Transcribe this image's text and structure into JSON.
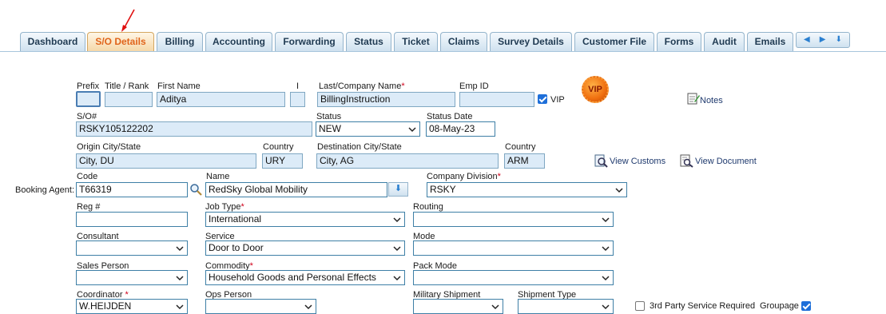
{
  "tabs": [
    {
      "label": "Dashboard"
    },
    {
      "label": "S/O Details"
    },
    {
      "label": "Billing"
    },
    {
      "label": "Accounting"
    },
    {
      "label": "Forwarding"
    },
    {
      "label": "Status"
    },
    {
      "label": "Ticket"
    },
    {
      "label": "Claims"
    },
    {
      "label": "Survey Details"
    },
    {
      "label": "Customer File"
    },
    {
      "label": "Forms"
    },
    {
      "label": "Audit"
    },
    {
      "label": "Emails"
    }
  ],
  "nav_arrows": {
    "left": "◀",
    "right": "▶",
    "down": "⬇"
  },
  "labels": {
    "prefix": "Prefix",
    "title_rank": "Title / Rank",
    "first_name": "First Name",
    "initial": "I",
    "last_company": "Last/Company Name",
    "emp_id": "Emp ID",
    "vip": "VIP",
    "notes": "Notes",
    "so_number": "S/O#",
    "status": "Status",
    "status_date": "Status Date",
    "origin_city": "Origin City/State",
    "origin_country": "Country",
    "dest_city": "Destination City/State",
    "dest_country": "Country",
    "view_customs": "View Customs",
    "view_document": "View Document",
    "booking_agent": "Booking Agent:",
    "code": "Code",
    "name": "Name",
    "company_division": "Company Division",
    "reg": "Reg #",
    "job_type": "Job Type",
    "routing": "Routing",
    "consultant": "Consultant",
    "service": "Service",
    "mode": "Mode",
    "sales_person": "Sales Person",
    "commodity": "Commodity",
    "pack_mode": "Pack Mode",
    "coordinator": "Coordinator",
    "ops_person": "Ops Person",
    "military_shipment": "Military Shipment",
    "shipment_type": "Shipment Type",
    "third_party": "3rd Party Service Required",
    "groupage": "Groupage"
  },
  "values": {
    "prefix": "",
    "title_rank": "",
    "first_name": "Aditya",
    "initial": "",
    "last_company": "BillingInstruction",
    "emp_id": "",
    "vip_badge": "VIP",
    "so_number": "RSKY105122202",
    "status": "NEW",
    "status_date": "08-May-23",
    "origin_city": "City, DU",
    "origin_country": "URY",
    "dest_city": "City, AG",
    "dest_country": "ARM",
    "code": "T66319",
    "name": "RedSky Global Mobility",
    "company_division": "RSKY",
    "reg": "",
    "job_type": "International",
    "routing": "",
    "consultant": "",
    "service": "Door to Door",
    "mode": "",
    "sales_person": "",
    "commodity": "Household Goods and Personal Effects",
    "pack_mode": "",
    "coordinator": "W.HEIJDEN",
    "ops_person": "",
    "military_shipment": "",
    "shipment_type": ""
  },
  "required_mark": "*",
  "checkboxes": {
    "vip": true,
    "third_party": false,
    "groupage": true
  },
  "colors": {
    "active_tab_text": "#e0641a",
    "tab_text": "#1f3a52",
    "input_bg": "#dcebf8",
    "required": "#d0021b"
  }
}
